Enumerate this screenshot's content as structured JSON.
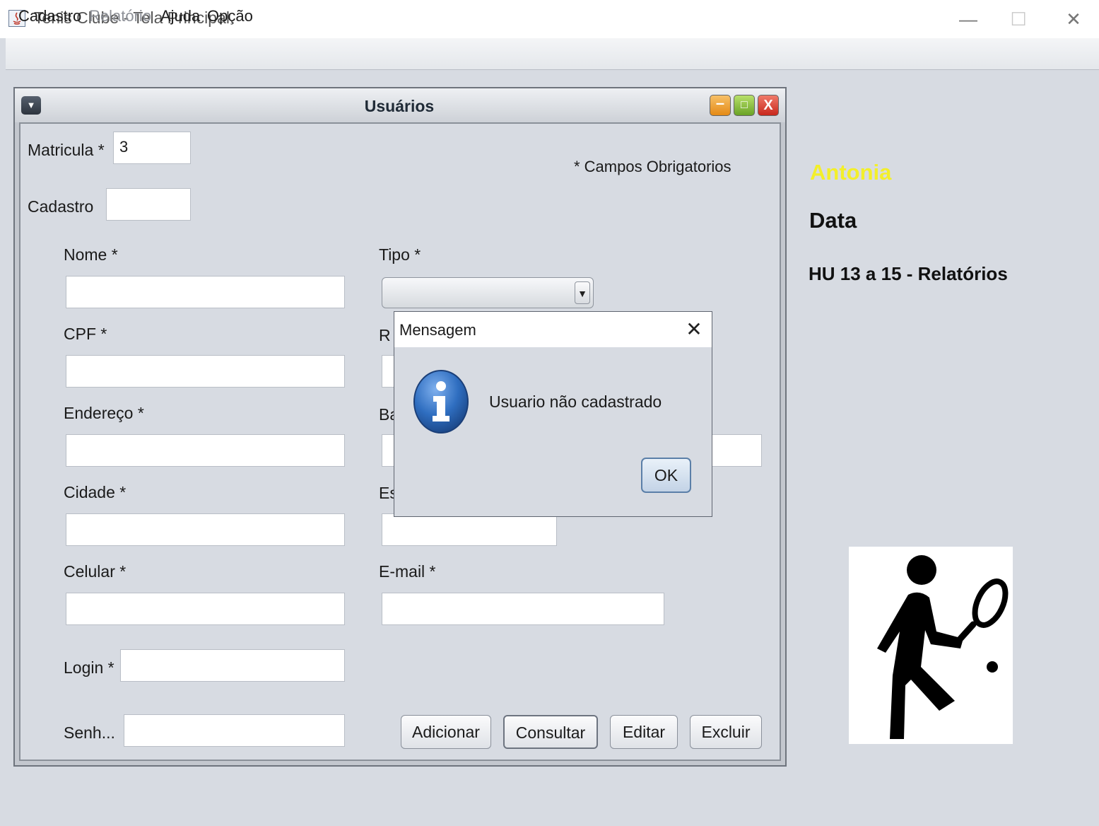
{
  "window": {
    "title": "Tenis Clube  -  Tela Principal",
    "minimize_glyph": "—",
    "maximize_glyph": "☐",
    "close_glyph": "✕"
  },
  "menubar": {
    "items": [
      "Cadastro",
      "Relatório",
      "Ajuda",
      "Opção"
    ],
    "disabled": [
      "Relatório"
    ]
  },
  "internal_frame": {
    "title": "Usuários",
    "required_note": "* Campos Obrigatorios",
    "fields": {
      "matricula": {
        "label": "Matricula *",
        "value": "3"
      },
      "cadastro": {
        "label": "Cadastro",
        "value": ""
      },
      "nome": {
        "label": "Nome *",
        "value": ""
      },
      "tipo": {
        "label": "Tipo *",
        "value": ""
      },
      "cpf": {
        "label": "CPF *",
        "value": ""
      },
      "rg": {
        "label_visible": "R",
        "value": ""
      },
      "endereco": {
        "label": "Endereço *",
        "value": ""
      },
      "bairro": {
        "label_visible": "Ba",
        "value": ""
      },
      "cidade": {
        "label": "Cidade *",
        "value": ""
      },
      "estado": {
        "label_visible": "Es",
        "value": ""
      },
      "celular": {
        "label": "Celular *",
        "value": ""
      },
      "email": {
        "label": "E-mail *",
        "value": ""
      },
      "login": {
        "label": "Login *",
        "value": ""
      },
      "senha": {
        "label": "Senh...",
        "value": ""
      }
    },
    "buttons": {
      "adicionar": "Adicionar",
      "consultar": "Consultar",
      "editar": "Editar",
      "excluir": "Excluir"
    }
  },
  "dialog": {
    "title": "Mensagem",
    "message": "Usuario não cadastrado",
    "ok": "OK",
    "close_glyph": "✕",
    "icon": "information-icon"
  },
  "side_panel": {
    "user_name": "Antonia",
    "date_label": "Data",
    "subtitle": "HU 13 a 15 - Relatórios",
    "image": "tennis-player-icon"
  },
  "colors": {
    "background": "#d7dbe2",
    "user_name": "#f3ef2a",
    "info_icon": "#2f6ec0"
  }
}
